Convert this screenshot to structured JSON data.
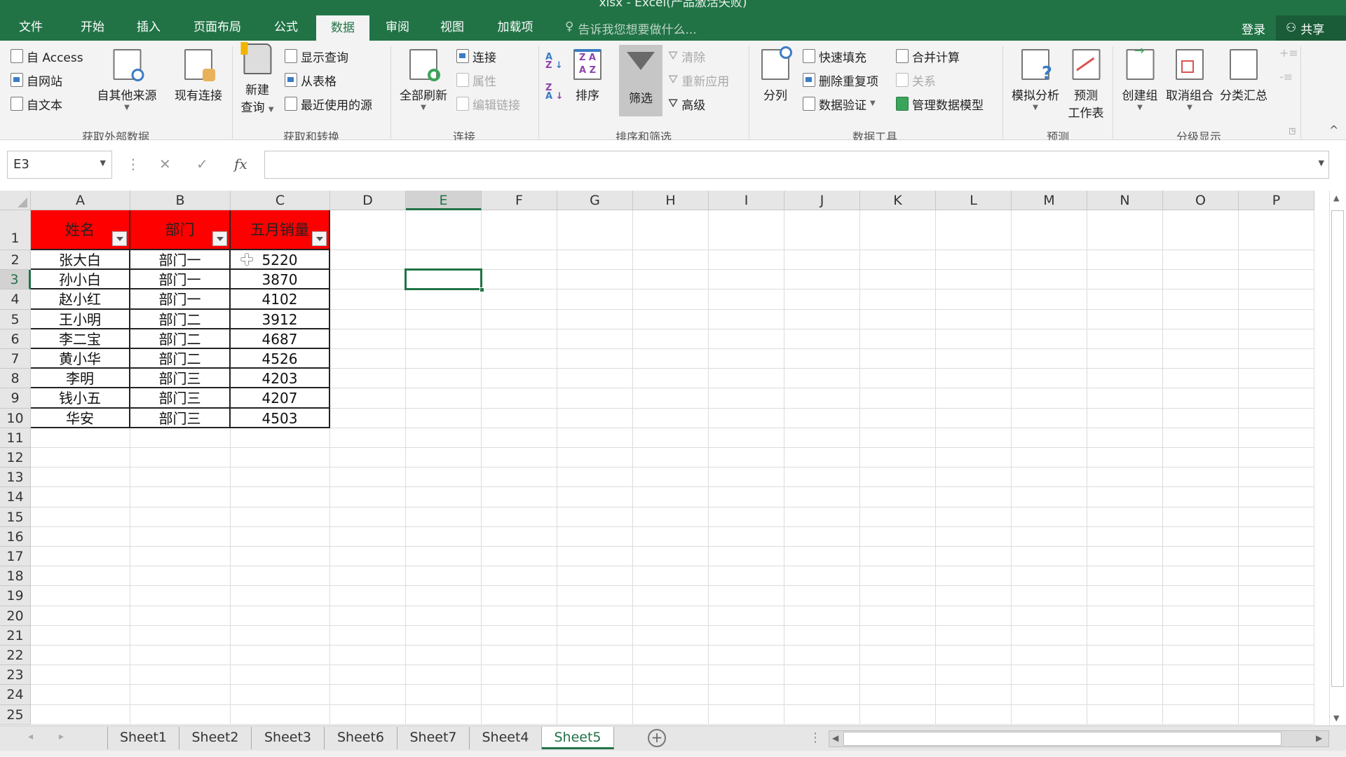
{
  "window": {
    "title": "xlsx - Excel(产品激活失败)"
  },
  "menu": {
    "tabs": [
      "文件",
      "开始",
      "插入",
      "页面布局",
      "公式",
      "数据",
      "审阅",
      "视图",
      "加载项"
    ],
    "active": "数据",
    "tell_me": "告诉我您想要做什么...",
    "login": "登录",
    "share": "共享"
  },
  "ribbon": {
    "get_external": {
      "label": "获取外部数据",
      "access": "自 Access",
      "web": "自网站",
      "text": "自文本",
      "other": "自其他来源",
      "existing": "现有连接"
    },
    "get_transform": {
      "label": "获取和转换",
      "new_query_1": "新建",
      "new_query_2": "查询",
      "show_queries": "显示查询",
      "from_table": "从表格",
      "recent": "最近使用的源"
    },
    "connections": {
      "label": "连接",
      "refresh_all": "全部刷新",
      "connections": "连接",
      "properties": "属性",
      "edit_links": "编辑链接"
    },
    "sort_filter": {
      "label": "排序和筛选",
      "sort": "排序",
      "filter": "筛选",
      "clear": "清除",
      "reapply": "重新应用",
      "advanced": "高级"
    },
    "data_tools": {
      "label": "数据工具",
      "text_to_columns": "分列",
      "flash_fill": "快速填充",
      "remove_duplicates": "删除重复项",
      "validation": "数据验证",
      "consolidate": "合并计算",
      "relationships": "关系",
      "manage_model": "管理数据模型"
    },
    "forecast": {
      "label": "预测",
      "what_if": "模拟分析",
      "forecast_sheet_1": "预测",
      "forecast_sheet_2": "工作表"
    },
    "outline": {
      "label": "分级显示",
      "group": "创建组",
      "ungroup": "取消组合",
      "subtotal": "分类汇总"
    }
  },
  "formula_bar": {
    "name_box": "E3",
    "fx": "fx",
    "value": ""
  },
  "sheet": {
    "columns": [
      "A",
      "B",
      "C",
      "D",
      "E",
      "F",
      "G",
      "H",
      "I",
      "J",
      "K",
      "L",
      "M",
      "N",
      "O",
      "P"
    ],
    "selected_cell": "E3",
    "header": [
      "姓名",
      "部门",
      "五月销量"
    ],
    "rows": [
      [
        "张大白",
        "部门一",
        "5220"
      ],
      [
        "孙小白",
        "部门一",
        "3870"
      ],
      [
        "赵小红",
        "部门一",
        "4102"
      ],
      [
        "王小明",
        "部门二",
        "3912"
      ],
      [
        "李二宝",
        "部门二",
        "4687"
      ],
      [
        "黄小华",
        "部门二",
        "4526"
      ],
      [
        "李明",
        "部门三",
        "4203"
      ],
      [
        "钱小五",
        "部门三",
        "4207"
      ],
      [
        "华安",
        "部门三",
        "4503"
      ]
    ],
    "header_color": "#FF0000",
    "accent": "#217346"
  },
  "sheet_tabs": {
    "tabs": [
      "Sheet1",
      "Sheet2",
      "Sheet3",
      "Sheet6",
      "Sheet7",
      "Sheet4",
      "Sheet5"
    ],
    "active": "Sheet5"
  }
}
